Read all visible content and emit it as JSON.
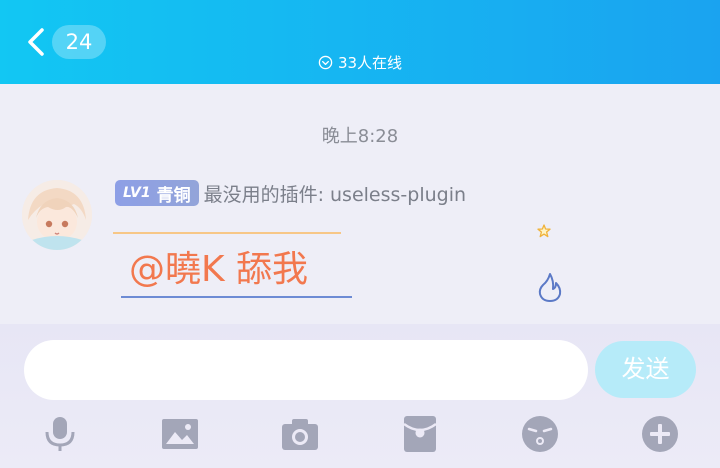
{
  "header": {
    "unread_count": "24",
    "online_text": "33人在线"
  },
  "chat": {
    "timestamp": "晚上8:28",
    "message": {
      "level_tag": "LV1",
      "level_name": "青铜",
      "sender": "最没用的插件: useless-plugin",
      "text": "@曉K 舔我"
    }
  },
  "input": {
    "value": "",
    "send_label": "发送"
  },
  "toolbar": {
    "icons": [
      "microphone-icon",
      "image-icon",
      "camera-icon",
      "red-packet-icon",
      "emoji-icon",
      "plus-icon"
    ]
  },
  "colors": {
    "header": "#1aa3f0",
    "message_text": "#f2784e",
    "send_button": "#b6ebf9",
    "toolbar_icon": "#a3a6b8"
  }
}
